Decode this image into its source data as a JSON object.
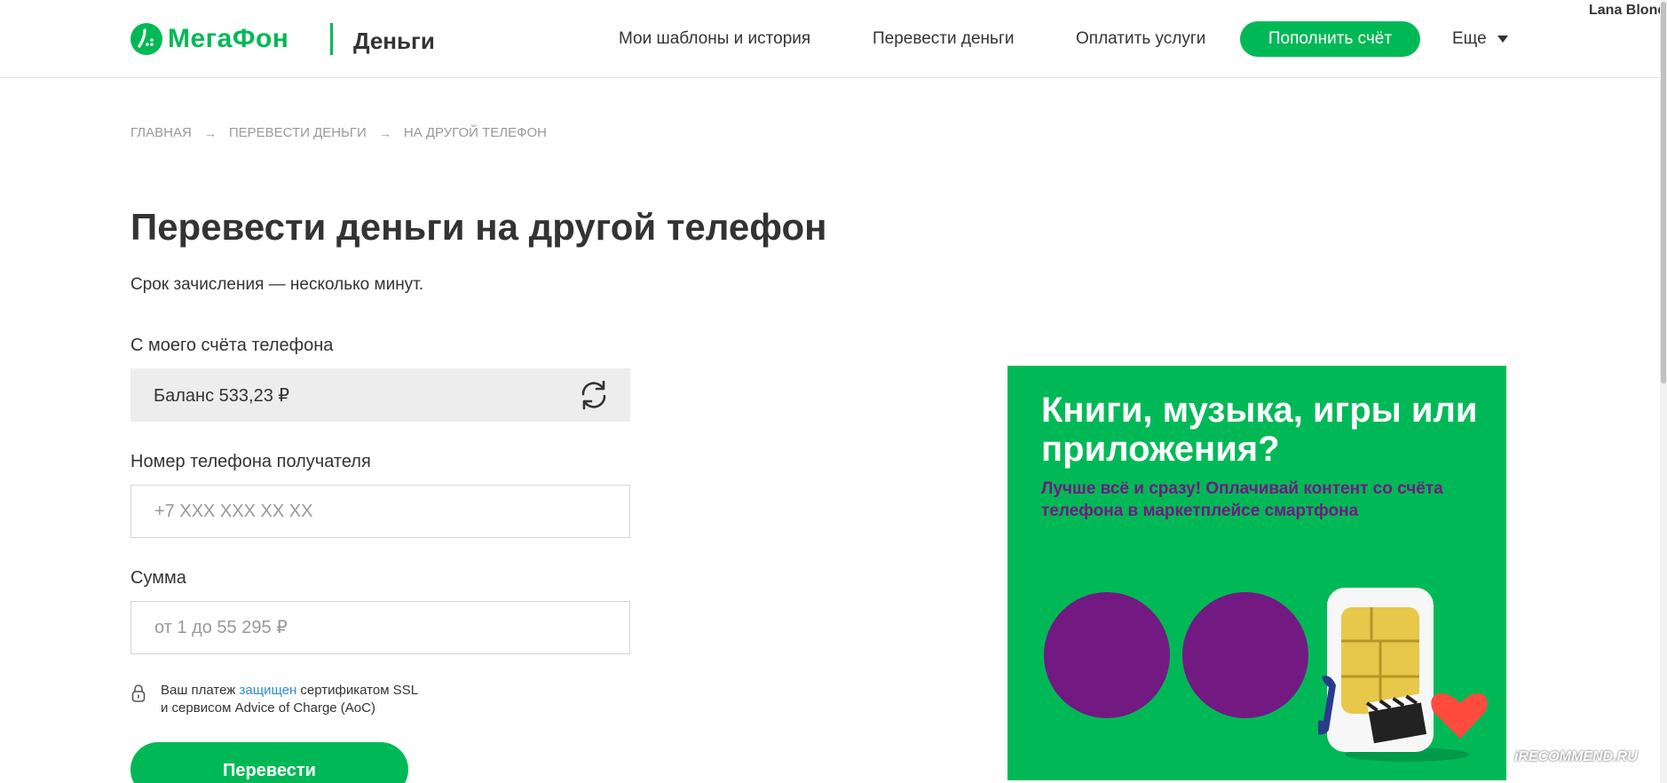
{
  "user": {
    "name": "Lana Blond"
  },
  "header": {
    "brand": "МегаФон",
    "section": "Деньги",
    "nav": [
      {
        "label": "Мои шаблоны и история"
      },
      {
        "label": "Перевести деньги"
      },
      {
        "label": "Оплатить услуги"
      }
    ],
    "topup_label": "Пополнить счёт",
    "more_label": "Еще"
  },
  "breadcrumb": [
    {
      "label": "Главная"
    },
    {
      "label": "Перевести деньги"
    },
    {
      "label": "На другой телефон"
    }
  ],
  "main": {
    "title": "Перевести деньги на другой телефон",
    "subtitle": "Срок зачисления — несколько минут.",
    "from_label": "С моего счёта телефона",
    "balance": "Баланс 533,23 ₽",
    "phone_label": "Номер телефона получателя",
    "phone_placeholder": "+7 XXX XXX XX XX",
    "phone_value": "",
    "amount_label": "Сумма",
    "amount_placeholder": "от 1 до 55 295 ₽",
    "amount_value": "",
    "ssl_before": "Ваш платеж ",
    "ssl_link": "защищен",
    "ssl_after": " сертификатом SSL",
    "ssl_line2": "и сервисом Advice of Charge (AoC)",
    "submit_label": "Перевести"
  },
  "banner": {
    "title": "Книги, музыка, игры или приложения?",
    "subtitle": "Лучше всё и сразу! Оплачивай контент со счёта телефона в маркетплейсе смартфона",
    "colors": {
      "background": "#00b956",
      "accent": "#731982"
    }
  },
  "watermark": "iRECOMMEND.RU",
  "colors": {
    "brand_green": "#00b956",
    "brand_purple": "#731982",
    "link": "#2b8fce"
  }
}
